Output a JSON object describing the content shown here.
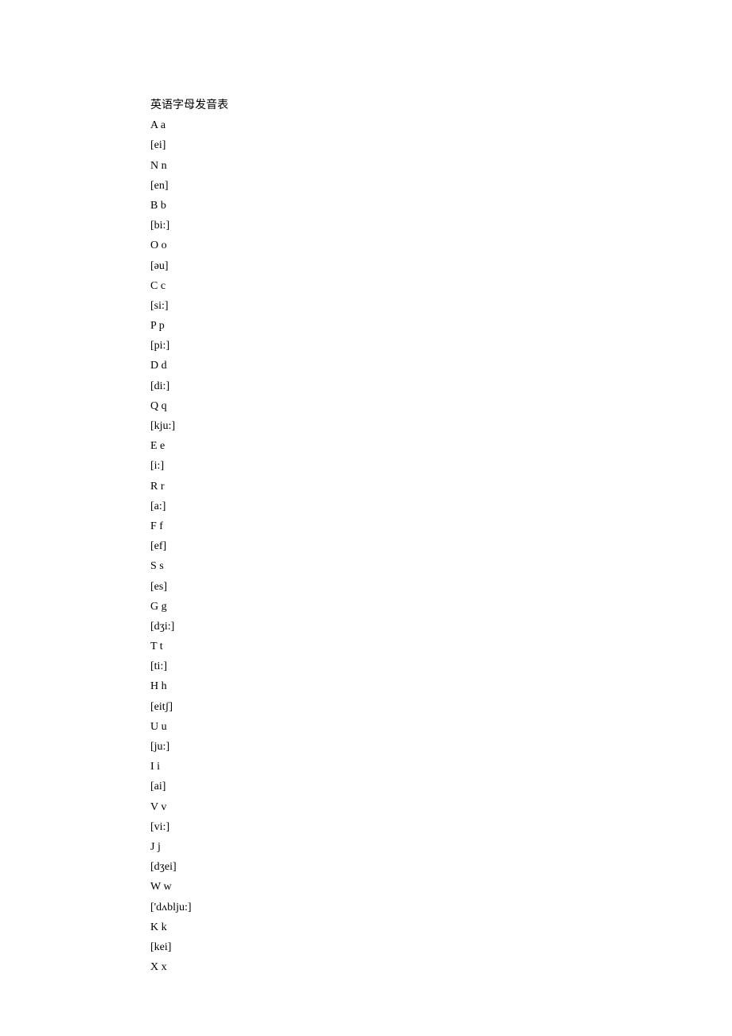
{
  "title": "英语字母发音表",
  "lines": [
    "A a",
    "[ei]",
    "N n",
    "[en]",
    "B b",
    "[bi:]",
    "O o",
    "[əu]",
    "C c",
    "[si:]",
    "P p",
    "[pi:]",
    "D d",
    "[di:]",
    "Q q",
    "[kju:]",
    "E e",
    "[i:]",
    "R r",
    "[a:]",
    "F f",
    "[ef]",
    "S s",
    "[es]",
    "G g",
    "[dʒi:]",
    "T t",
    "[ti:]",
    "H h",
    "[eitʃ]",
    "U u",
    "[ju:]",
    "I i",
    "[ai]",
    "V v",
    "[vi:]",
    "J j",
    "[dʒei]",
    "W w",
    "['dʌblju:]",
    "K k",
    "[kei]",
    "X x"
  ]
}
